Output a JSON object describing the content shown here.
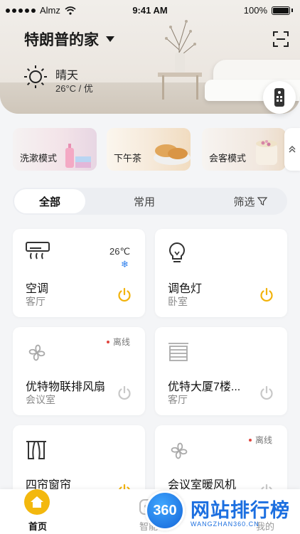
{
  "status_bar": {
    "carrier": "Almz",
    "time": "9:41 AM",
    "battery": "100%"
  },
  "header": {
    "home_name": "特朗普的家",
    "weather": {
      "condition": "晴天",
      "detail": "26°C / 优"
    }
  },
  "scenes": [
    {
      "label": "洗漱模式"
    },
    {
      "label": "下午茶"
    },
    {
      "label": "会客模式"
    }
  ],
  "tabs": {
    "all": "全部",
    "common": "常用",
    "filter": "筛选"
  },
  "devices": [
    {
      "name": "空调",
      "room": "客厅",
      "temp": "26℃",
      "icon": "air-conditioner-icon",
      "power_color": "#f2b30c"
    },
    {
      "name": "调色灯",
      "room": "卧室",
      "icon": "bulb-icon",
      "power_color": "#f2b30c"
    },
    {
      "name": "优特物联排风扇",
      "room": "会议室",
      "status": "离线",
      "icon": "fan-icon",
      "power_color": "#c8c8c8"
    },
    {
      "name": "优特大厦7楼...",
      "room": "客厅",
      "icon": "curtain-box-icon",
      "power_color": "#c8c8c8"
    },
    {
      "name": "四帘窗帘",
      "icon": "curtain-icon",
      "power_color": "#f2b30c"
    },
    {
      "name": "会议室暖风机",
      "status": "离线",
      "icon": "fan-icon",
      "power_color": "#c8c8c8"
    }
  ],
  "bottom_nav": {
    "home": "首页",
    "smart": "智能",
    "mine": "我的"
  },
  "watermark": {
    "logo": "360",
    "title": "网站排行榜",
    "url": "WANGZHAN360.CN"
  },
  "colors": {
    "accent": "#f3b80e",
    "offline_dot": "#e0443e",
    "snow": "#2f80ed"
  }
}
